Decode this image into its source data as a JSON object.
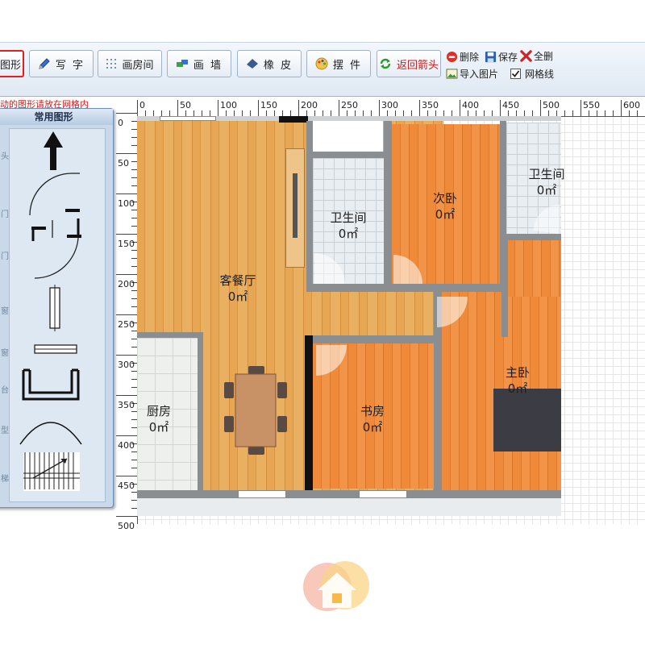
{
  "toolbar": {
    "shapes_label": "图形",
    "write_label": "写 字",
    "draw_room_label": "画房间",
    "draw_wall_label": "画 墙",
    "eraser_label": "橡 皮",
    "furniture_label": "摆 件",
    "back_arrow_label": "返回箭头",
    "delete_label": "删除",
    "save_label": "保存",
    "clear_all_label": "全删",
    "import_image_label": "导入图片",
    "grid_lines_label": "网格线",
    "grid_lines_checked": true,
    "active_color": "#e02020"
  },
  "hint": "动的图形请放在网格内",
  "ruler": {
    "x_ticks": [
      "0",
      "50",
      "100",
      "150",
      "200",
      "250",
      "300",
      "350",
      "400",
      "450",
      "500",
      "550",
      "600"
    ],
    "y_ticks": [
      "0",
      "50",
      "100",
      "150",
      "200",
      "250",
      "300",
      "350",
      "400",
      "450",
      "500"
    ]
  },
  "panel": {
    "title": "常用图形",
    "labels": [
      "头",
      "门",
      "门",
      "窗",
      "窗",
      "台",
      "型",
      "梯"
    ],
    "icons": [
      "up-arrow-icon",
      "door-single-icon",
      "door-double-icon",
      "window-vertical-icon",
      "window-horizontal-icon",
      "balcony-icon",
      "arc-icon",
      "stairs-icon"
    ]
  },
  "plan": {
    "rooms": [
      {
        "name": "客餐厅",
        "area": "0㎡"
      },
      {
        "name": "卫生间",
        "area": "0㎡"
      },
      {
        "name": "次卧",
        "area": "0㎡"
      },
      {
        "name": "卫生间",
        "area": "0㎡"
      },
      {
        "name": "厨房",
        "area": "0㎡"
      },
      {
        "name": "书房",
        "area": "0㎡"
      },
      {
        "name": "主卧",
        "area": "0㎡"
      }
    ]
  },
  "colors": {
    "wood": "#e7a653",
    "orange_wood": "#ee8a3a",
    "wall": "#8a8e91",
    "hint": "#e01818",
    "toolbar_bg": "#dfe8f3"
  }
}
